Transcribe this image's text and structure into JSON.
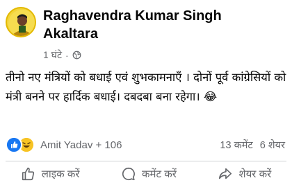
{
  "post": {
    "author": "Raghavendra Kumar Singh Akaltara",
    "time": "1 घंटे",
    "privacy_icon": "globe-icon",
    "text": "तीनो नए मंत्रियों को बधाई एवं शुभकामनाएँ । दोनों पूर्व कांग्रेसियों को मंत्री बनने पर हार्दिक बधाई। दबदबा बना रहेगा। 😂"
  },
  "reactions": {
    "icons": [
      "like-icon",
      "haha-icon"
    ],
    "summary": "Amit Yadav + 106",
    "comments": "13 कमेंट",
    "shares": "6 शेयर"
  },
  "actions": {
    "like": "लाइक करें",
    "comment": "कमेंट करें",
    "share": "शेयर करें"
  },
  "colors": {
    "like_blue": "#1877f2",
    "haha_yellow": "#f7c324",
    "muted_text": "#65676b",
    "divider": "#ced0d4"
  }
}
